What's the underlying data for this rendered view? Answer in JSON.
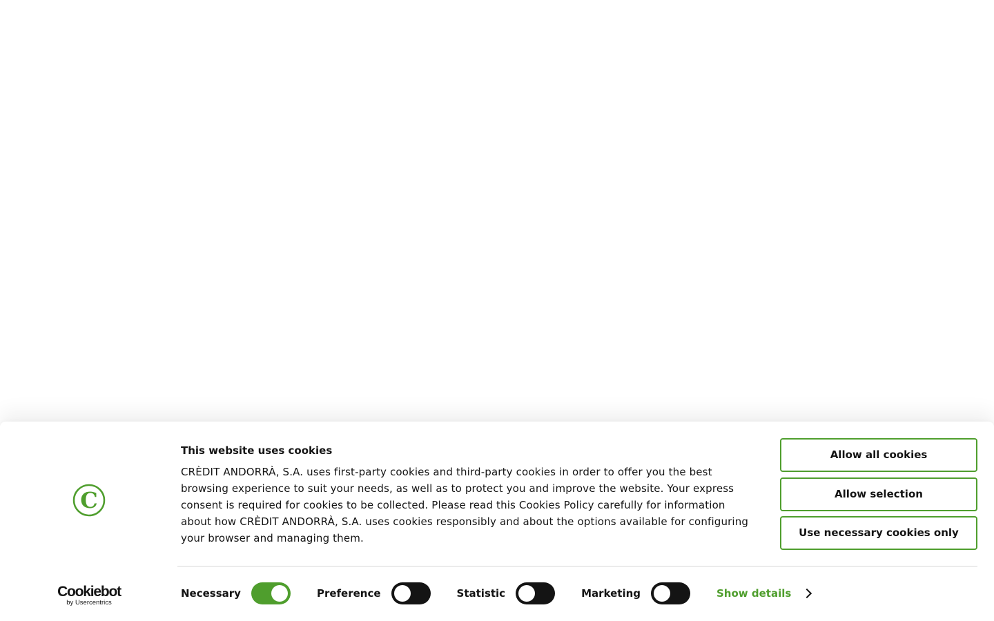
{
  "banner": {
    "title": "This website uses cookies",
    "description": "CRÈDIT ANDORRÀ, S.A. uses first-party cookies and third-party cookies in order to offer you the best browsing experience to suit your needs, as well as to protect you and improve the website. Your express consent is required for cookies to be collected.  Please read this Cookies Policy carefully for information about how CRÈDIT ANDORRÀ, S.A. uses cookies responsibly and about the options available for configuring your browser and managing them.",
    "brand_color": "#4f9e2d",
    "text_color": "#141414"
  },
  "buttons": {
    "allow_all": "Allow all cookies",
    "allow_selection": "Allow selection",
    "necessary_only": "Use necessary cookies only"
  },
  "toggles": [
    {
      "label": "Necessary",
      "checked": true
    },
    {
      "label": "Preference",
      "checked": false
    },
    {
      "label": "Statistic",
      "checked": false
    },
    {
      "label": "Marketing",
      "checked": false
    }
  ],
  "show_details": "Show details",
  "logos": {
    "brand_letter": "C",
    "cookiebot_name": "Cookiebot",
    "cookiebot_sub": "by Usercentrics"
  },
  "icons": {
    "brand": "credit-andorra-logo-icon",
    "details": "chevron-right-icon"
  }
}
